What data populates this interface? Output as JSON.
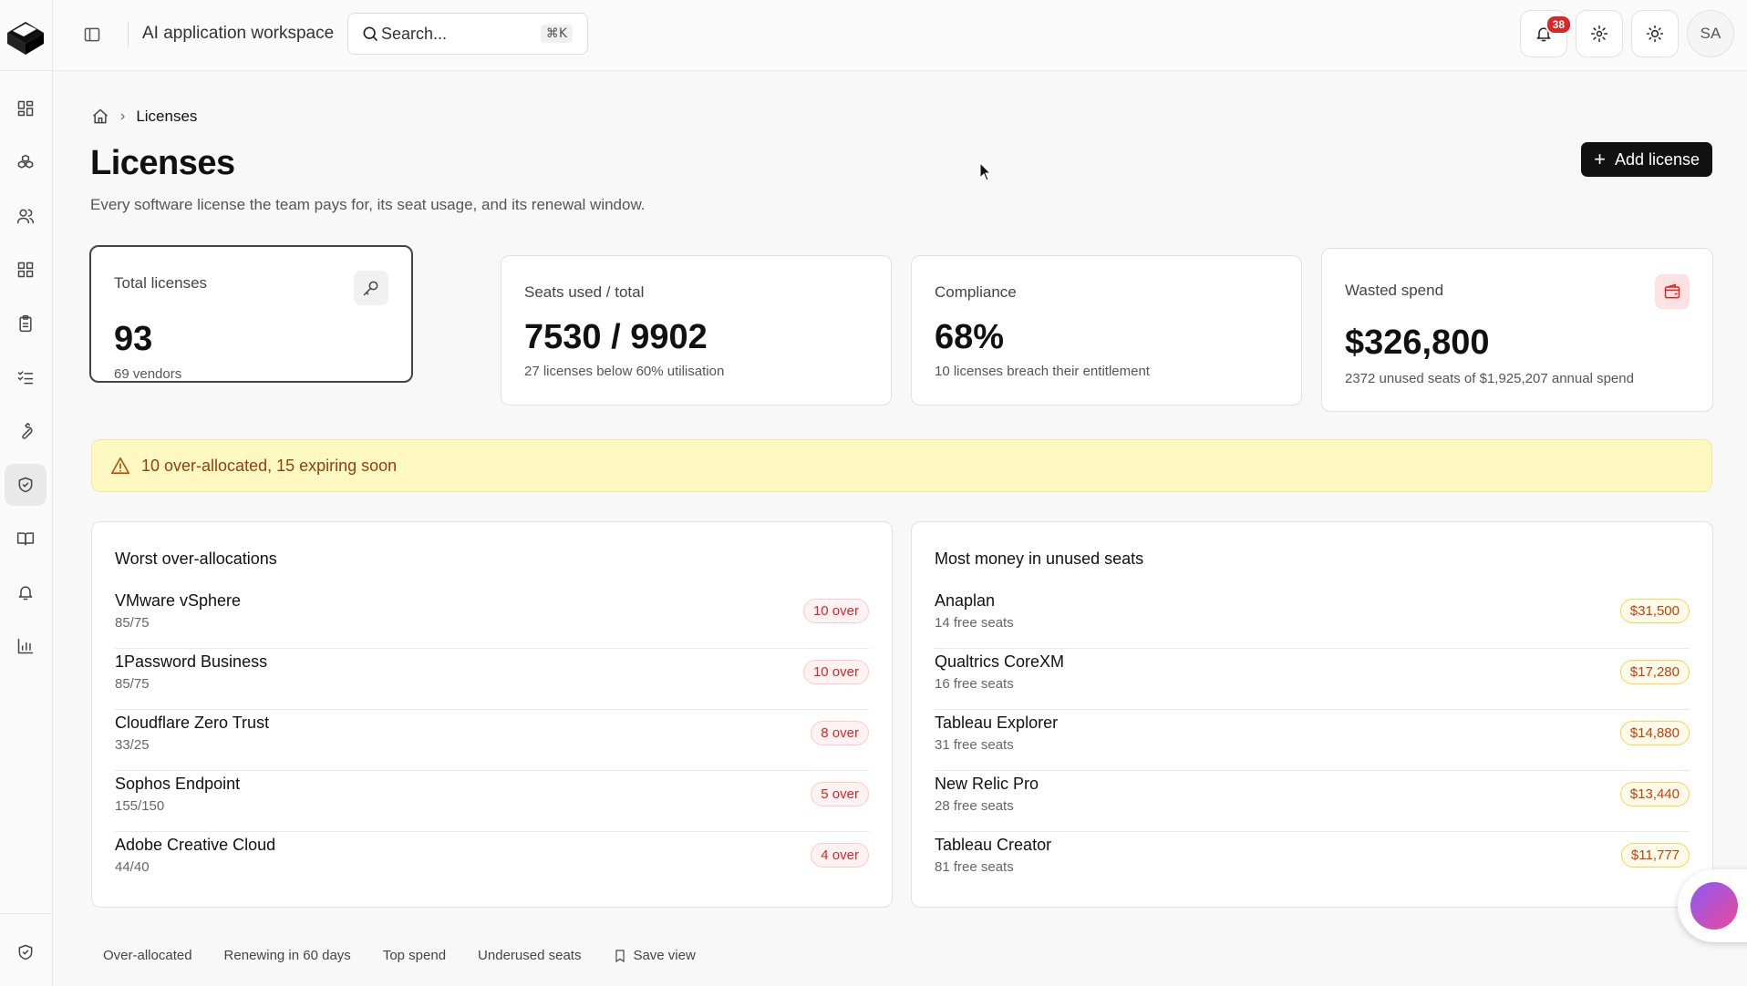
{
  "topbar": {
    "workspace": "AI application workspace",
    "search_placeholder": "Search...",
    "search_shortcut": "⌘K",
    "notification_count": "38",
    "avatar_initials": "SA"
  },
  "breadcrumb": {
    "current": "Licenses"
  },
  "page": {
    "title": "Licenses",
    "subtitle": "Every software license the team pays for, its seat usage, and its renewal window.",
    "add_button": "Add license"
  },
  "stats": [
    {
      "label": "Total licenses",
      "value": "93",
      "sub": "69 vendors",
      "icon": "key-icon"
    },
    {
      "label": "Seats used / total",
      "value": "7530 / 9902",
      "sub": "27 licenses below 60% utilisation"
    },
    {
      "label": "Compliance",
      "value": "68%",
      "sub": "10 licenses breach their entitlement"
    },
    {
      "label": "Wasted spend",
      "value": "$326,800",
      "sub": "2372 unused seats of $1,925,207 annual spend",
      "icon": "wallet-icon"
    }
  ],
  "alert": {
    "text": "10 over-allocated, 15 expiring soon"
  },
  "over_allocations": {
    "title": "Worst over-allocations",
    "rows": [
      {
        "name": "VMware vSphere",
        "sub": "85/75",
        "badge": "10 over"
      },
      {
        "name": "1Password Business",
        "sub": "85/75",
        "badge": "10 over"
      },
      {
        "name": "Cloudflare Zero Trust",
        "sub": "33/25",
        "badge": "8 over"
      },
      {
        "name": "Sophos Endpoint",
        "sub": "155/150",
        "badge": "5 over"
      },
      {
        "name": "Adobe Creative Cloud",
        "sub": "44/40",
        "badge": "4 over"
      }
    ]
  },
  "unused_seats": {
    "title": "Most money in unused seats",
    "rows": [
      {
        "name": "Anaplan",
        "sub": "14 free seats",
        "badge": "$31,500"
      },
      {
        "name": "Qualtrics CoreXM",
        "sub": "16 free seats",
        "badge": "$17,280"
      },
      {
        "name": "Tableau Explorer",
        "sub": "31 free seats",
        "badge": "$14,880"
      },
      {
        "name": "New Relic Pro",
        "sub": "28 free seats",
        "badge": "$13,440"
      },
      {
        "name": "Tableau Creator",
        "sub": "81 free seats",
        "badge": "$11,777"
      }
    ]
  },
  "bottom_tabs": [
    "Over-allocated",
    "Renewing in 60 days",
    "Top spend",
    "Underused seats",
    "Save view"
  ],
  "colors": {
    "accent": "#111111",
    "alert_bg": "#fef9c3",
    "danger": "#dc2626",
    "amber": "#c2410c"
  }
}
